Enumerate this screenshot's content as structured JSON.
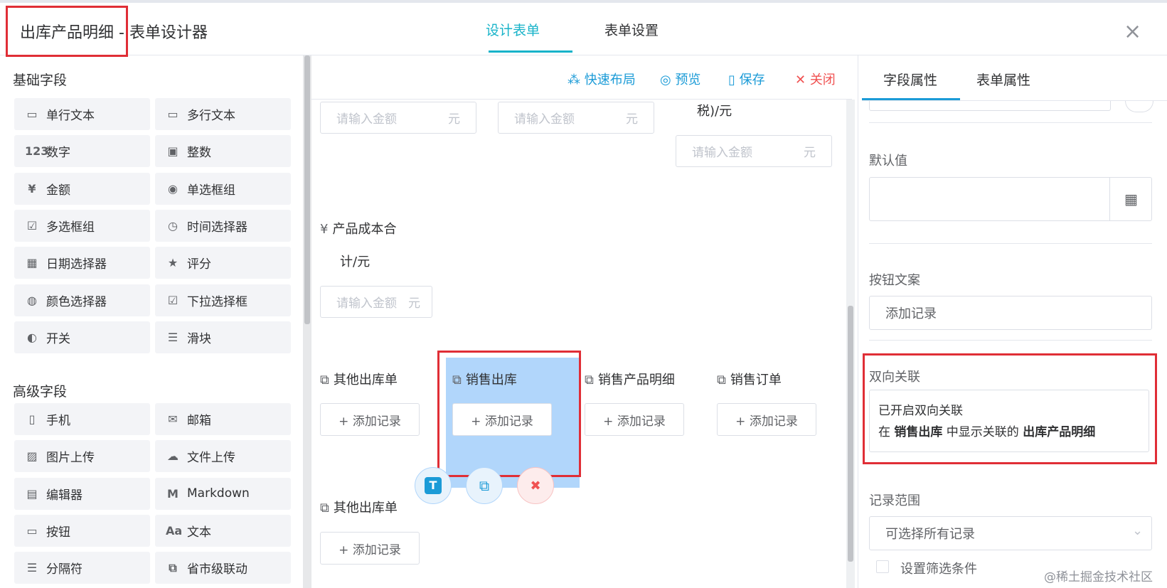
{
  "header": {
    "form_name": "出库产品明细",
    "separator": " - ",
    "designer_title": "表单设计器",
    "tab_design": "设计表单",
    "tab_settings": "表单设置",
    "close_symbol": "×"
  },
  "left": {
    "basic_title": "基础字段",
    "advanced_title": "高级字段",
    "basic_items": [
      {
        "label": "单行文本",
        "icon": "▭"
      },
      {
        "label": "多行文本",
        "icon": "▭"
      },
      {
        "label": "数字",
        "icon": "123"
      },
      {
        "label": "整数",
        "icon": "▣"
      },
      {
        "label": "金额",
        "icon": "¥"
      },
      {
        "label": "单选框组",
        "icon": "◉"
      },
      {
        "label": "多选框组",
        "icon": "☑"
      },
      {
        "label": "时间选择器",
        "icon": "◷"
      },
      {
        "label": "日期选择器",
        "icon": "▦"
      },
      {
        "label": "评分",
        "icon": "★"
      },
      {
        "label": "颜色选择器",
        "icon": "◍"
      },
      {
        "label": "下拉选择框",
        "icon": "☑"
      },
      {
        "label": "开关",
        "icon": "◐"
      },
      {
        "label": "滑块",
        "icon": "☰"
      }
    ],
    "advanced_items": [
      {
        "label": "手机",
        "icon": "▯"
      },
      {
        "label": "邮箱",
        "icon": "✉"
      },
      {
        "label": "图片上传",
        "icon": "▨"
      },
      {
        "label": "文件上传",
        "icon": "☁"
      },
      {
        "label": "编辑器",
        "icon": "▤"
      },
      {
        "label": "Markdown",
        "icon": "M"
      },
      {
        "label": "按钮",
        "icon": "▭"
      },
      {
        "label": "文本",
        "icon": "Aa"
      },
      {
        "label": "分隔符",
        "icon": "☰"
      },
      {
        "label": "省市级联动",
        "icon": "⧉"
      }
    ]
  },
  "toolbar": {
    "quick_layout": "快速布局",
    "preview": "预览",
    "save": "保存",
    "close": "关闭"
  },
  "canvas": {
    "amount_placeholder": "请输入金额",
    "unit": "元",
    "tax_label_tail": "税)/元",
    "cost_label_1": "产品成本合",
    "cost_label_2": "计/元",
    "cost_placeholder": "请输入金额",
    "relations": [
      {
        "label": "其他出库单"
      },
      {
        "label": "销售出库"
      },
      {
        "label": "销售产品明细"
      },
      {
        "label": "销售订单"
      },
      {
        "label": "其他出库单"
      }
    ],
    "add_record": "+ 添加记录",
    "float_text_icon": "T",
    "float_copy_icon": "⧉",
    "float_delete_icon": "🗑"
  },
  "right": {
    "tab_field": "字段属性",
    "tab_form": "表单属性",
    "default_value_label": "默认值",
    "default_value": "",
    "button_text_label": "按钮文案",
    "button_text_value": "添加记录",
    "bidirectional_label": "双向关联",
    "bidirectional_line1": "已开启双向关联",
    "bidirectional_pre": "在 ",
    "bidirectional_target": "销售出库",
    "bidirectional_mid": " 中显示关联的 ",
    "bidirectional_source": "出库产品明细",
    "range_label": "记录范围",
    "range_value": "可选择所有记录",
    "filter_checkbox_label": "设置筛选条件"
  },
  "watermark": "@稀土掘金技术社区",
  "colors": {
    "accent": "#18b3c9",
    "link": "#1b9bd7",
    "danger": "#f05151",
    "highlight": "#e02e36",
    "selected_bg": "#b1d6fb"
  }
}
